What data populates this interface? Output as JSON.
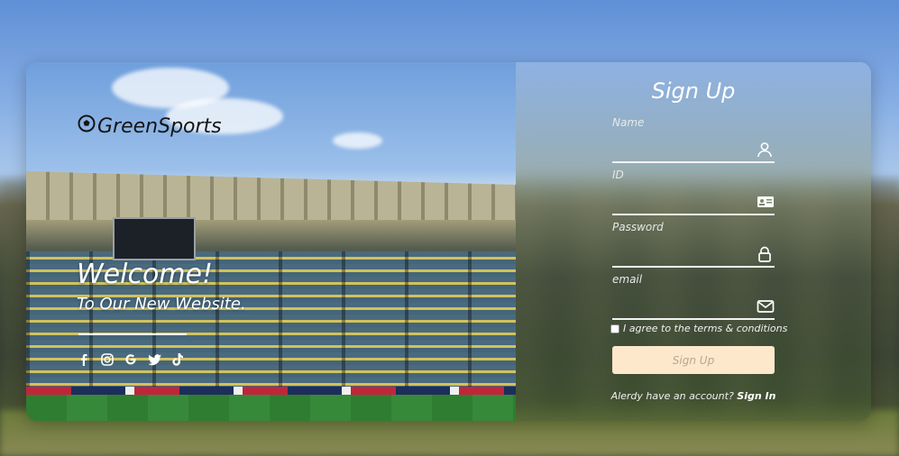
{
  "brand": {
    "name": "GreenSports"
  },
  "hero": {
    "welcome": "Welcome!",
    "tagline": "To Our New Website."
  },
  "social": [
    {
      "icon": "facebook-icon",
      "glyph": "f"
    },
    {
      "icon": "instagram-icon",
      "glyph": "◎"
    },
    {
      "icon": "google-icon",
      "glyph": "G"
    },
    {
      "icon": "twitter-icon",
      "glyph": "✦"
    },
    {
      "icon": "tiktok-icon",
      "glyph": "♪"
    }
  ],
  "form": {
    "title": "Sign Up",
    "fields": {
      "name": {
        "label": "Name",
        "value": "",
        "icon": "user-icon"
      },
      "id": {
        "label": "ID",
        "value": "",
        "icon": "id-card-icon"
      },
      "password": {
        "label": "Password",
        "value": "",
        "icon": "lock-icon"
      },
      "email": {
        "label": "email",
        "value": "",
        "icon": "mail-icon"
      }
    },
    "terms_label": "I agree to the terms & conditions",
    "submit_label": "Sign Up",
    "account_prompt": "Alerdy have an account?",
    "signin_label": "Sign In"
  },
  "colors": {
    "button_bg": "#fde8cc",
    "button_text": "#b9a78a",
    "text_light": "#ffffff"
  }
}
